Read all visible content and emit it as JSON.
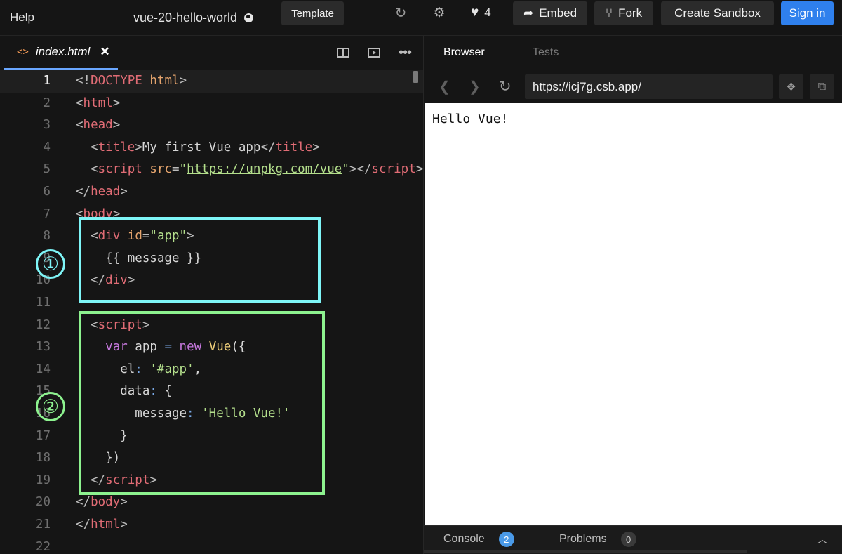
{
  "topbar": {
    "help": "Help",
    "sandbox_title": "vue-20-hello-world",
    "template_label": "Template",
    "likes": "4",
    "embed_label": "Embed",
    "fork_label": "Fork",
    "create_label": "Create Sandbox",
    "signin_label": "Sign in"
  },
  "editor": {
    "file_tab": "index.html",
    "current_line": 1,
    "lines": [
      {
        "n": "1",
        "t": [
          [
            "p",
            "<!"
          ],
          [
            "t",
            "DOCTYPE"
          ],
          [
            "x",
            " "
          ],
          [
            "a",
            "html"
          ],
          [
            "p",
            ">"
          ]
        ]
      },
      {
        "n": "2",
        "t": [
          [
            "p",
            "<"
          ],
          [
            "t",
            "html"
          ],
          [
            "p",
            ">"
          ]
        ]
      },
      {
        "n": "3",
        "t": [
          [
            "p",
            "<"
          ],
          [
            "t",
            "head"
          ],
          [
            "p",
            ">"
          ]
        ]
      },
      {
        "n": "4",
        "t": [
          [
            "x",
            "  "
          ],
          [
            "p",
            "<"
          ],
          [
            "t",
            "title"
          ],
          [
            "p",
            ">"
          ],
          [
            "x",
            "My first Vue app"
          ],
          [
            "p",
            "</"
          ],
          [
            "t",
            "title"
          ],
          [
            "p",
            ">"
          ]
        ]
      },
      {
        "n": "5",
        "t": [
          [
            "x",
            "  "
          ],
          [
            "p",
            "<"
          ],
          [
            "t",
            "script"
          ],
          [
            "x",
            " "
          ],
          [
            "a",
            "src"
          ],
          [
            "p",
            "="
          ],
          [
            "s",
            "\""
          ],
          [
            "u",
            "https://unpkg.com/vue"
          ],
          [
            "s",
            "\""
          ],
          [
            "p",
            "></"
          ],
          [
            "t",
            "script"
          ],
          [
            "p",
            ">"
          ]
        ]
      },
      {
        "n": "6",
        "t": [
          [
            "p",
            "</"
          ],
          [
            "t",
            "head"
          ],
          [
            "p",
            ">"
          ]
        ]
      },
      {
        "n": "7",
        "t": [
          [
            "p",
            "<"
          ],
          [
            "t",
            "body"
          ],
          [
            "p",
            ">"
          ]
        ]
      },
      {
        "n": "8",
        "t": [
          [
            "x",
            "  "
          ],
          [
            "p",
            "<"
          ],
          [
            "t",
            "div"
          ],
          [
            "x",
            " "
          ],
          [
            "a",
            "id"
          ],
          [
            "p",
            "="
          ],
          [
            "s",
            "\"app\""
          ],
          [
            "p",
            ">"
          ]
        ]
      },
      {
        "n": "9",
        "t": [
          [
            "x",
            "    {{ message }}"
          ]
        ]
      },
      {
        "n": "10",
        "t": [
          [
            "x",
            "  "
          ],
          [
            "p",
            "</"
          ],
          [
            "t",
            "div"
          ],
          [
            "p",
            ">"
          ]
        ]
      },
      {
        "n": "11",
        "t": []
      },
      {
        "n": "12",
        "t": [
          [
            "x",
            "  "
          ],
          [
            "p",
            "<"
          ],
          [
            "t",
            "script"
          ],
          [
            "p",
            ">"
          ]
        ]
      },
      {
        "n": "13",
        "t": [
          [
            "x",
            "    "
          ],
          [
            "k",
            "var"
          ],
          [
            "x",
            " app "
          ],
          [
            "o",
            "="
          ],
          [
            "x",
            " "
          ],
          [
            "k",
            "new"
          ],
          [
            "x",
            " "
          ],
          [
            "c",
            "Vue"
          ],
          [
            "x",
            "({"
          ]
        ]
      },
      {
        "n": "14",
        "t": [
          [
            "x",
            "      el"
          ],
          [
            "o",
            ":"
          ],
          [
            "x",
            " "
          ],
          [
            "s",
            "'#app'"
          ],
          [
            "x",
            ","
          ]
        ]
      },
      {
        "n": "15",
        "t": [
          [
            "x",
            "      data"
          ],
          [
            "o",
            ":"
          ],
          [
            "x",
            " {"
          ]
        ]
      },
      {
        "n": "16",
        "t": [
          [
            "x",
            "        message"
          ],
          [
            "o",
            ":"
          ],
          [
            "x",
            " "
          ],
          [
            "s",
            "'Hello Vue!'"
          ]
        ]
      },
      {
        "n": "17",
        "t": [
          [
            "x",
            "      }"
          ]
        ]
      },
      {
        "n": "18",
        "t": [
          [
            "x",
            "    })"
          ]
        ]
      },
      {
        "n": "19",
        "t": [
          [
            "x",
            "  "
          ],
          [
            "p",
            "</"
          ],
          [
            "t",
            "script"
          ],
          [
            "p",
            ">"
          ]
        ]
      },
      {
        "n": "20",
        "t": [
          [
            "p",
            "</"
          ],
          [
            "t",
            "body"
          ],
          [
            "p",
            ">"
          ]
        ]
      },
      {
        "n": "21",
        "t": [
          [
            "p",
            "</"
          ],
          [
            "t",
            "html"
          ],
          [
            "p",
            ">"
          ]
        ]
      },
      {
        "n": "22",
        "t": []
      }
    ]
  },
  "annotations": {
    "marker_1": "①",
    "marker_2": "②",
    "colors": {
      "marker_1": "#7ef5f7",
      "marker_2": "#8df28f"
    }
  },
  "browser": {
    "tab_browser": "Browser",
    "tab_tests": "Tests",
    "url": "https://icj7g.csb.app/",
    "content_text": "Hello Vue!",
    "console_label": "Console",
    "console_count": "2",
    "problems_label": "Problems",
    "problems_count": "0"
  },
  "colors": {
    "accent_signin": "#2f80ed",
    "background": "#151515"
  }
}
